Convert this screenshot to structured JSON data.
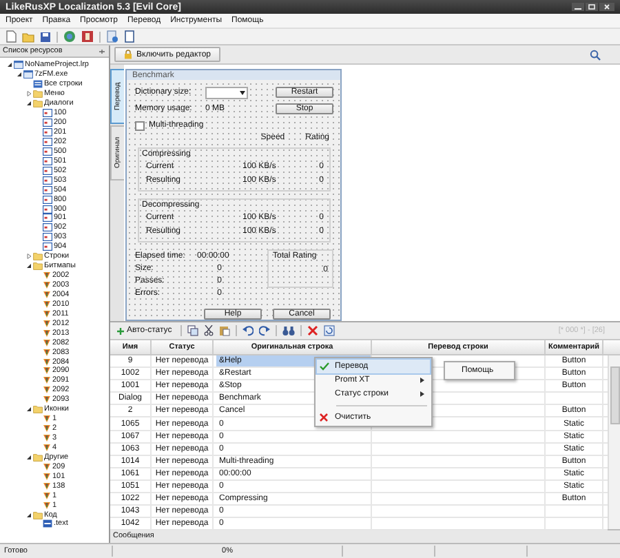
{
  "window": {
    "title": "LikeRusXP Localization 5.3  [Evil Core]"
  },
  "menu": [
    "Проект",
    "Правка",
    "Просмотр",
    "Перевод",
    "Инструменты",
    "Помощь"
  ],
  "resources": {
    "title": "Список ресурсов",
    "tree": [
      {
        "label": "NoNameProject.lrp",
        "kind": "project",
        "expanded": true,
        "children": [
          {
            "label": "7zFM.exe",
            "kind": "exe",
            "expanded": true,
            "children": [
              {
                "label": "Все строки",
                "kind": "list"
              },
              {
                "label": "Меню",
                "kind": "folder",
                "expanded": false
              },
              {
                "label": "Диалоги",
                "kind": "folder",
                "expanded": true,
                "children": [
                  {
                    "label": "100",
                    "kind": "dialog"
                  },
                  {
                    "label": "200",
                    "kind": "dialog"
                  },
                  {
                    "label": "201",
                    "kind": "dialog"
                  },
                  {
                    "label": "202",
                    "kind": "dialog"
                  },
                  {
                    "label": "500",
                    "kind": "dialog"
                  },
                  {
                    "label": "501",
                    "kind": "dialog"
                  },
                  {
                    "label": "502",
                    "kind": "dialog"
                  },
                  {
                    "label": "503",
                    "kind": "dialog"
                  },
                  {
                    "label": "504",
                    "kind": "dialog"
                  },
                  {
                    "label": "800",
                    "kind": "dialog"
                  },
                  {
                    "label": "900",
                    "kind": "dialog"
                  },
                  {
                    "label": "901",
                    "kind": "dialog"
                  },
                  {
                    "label": "902",
                    "kind": "dialog"
                  },
                  {
                    "label": "903",
                    "kind": "dialog"
                  },
                  {
                    "label": "904",
                    "kind": "dialog"
                  }
                ]
              },
              {
                "label": "Строки",
                "kind": "folder",
                "expanded": false
              },
              {
                "label": "Битмапы",
                "kind": "folder",
                "expanded": true,
                "children": [
                  {
                    "label": "2002",
                    "kind": "image"
                  },
                  {
                    "label": "2003",
                    "kind": "image"
                  },
                  {
                    "label": "2004",
                    "kind": "image"
                  },
                  {
                    "label": "2010",
                    "kind": "image"
                  },
                  {
                    "label": "2011",
                    "kind": "image"
                  },
                  {
                    "label": "2012",
                    "kind": "image"
                  },
                  {
                    "label": "2013",
                    "kind": "image"
                  },
                  {
                    "label": "2082",
                    "kind": "image"
                  },
                  {
                    "label": "2083",
                    "kind": "image"
                  },
                  {
                    "label": "2084",
                    "kind": "image"
                  },
                  {
                    "label": "2090",
                    "kind": "image"
                  },
                  {
                    "label": "2091",
                    "kind": "image"
                  },
                  {
                    "label": "2092",
                    "kind": "image"
                  },
                  {
                    "label": "2093",
                    "kind": "image"
                  }
                ]
              },
              {
                "label": "Иконки",
                "kind": "folder",
                "expanded": true,
                "children": [
                  {
                    "label": "1",
                    "kind": "image"
                  },
                  {
                    "label": "2",
                    "kind": "image"
                  },
                  {
                    "label": "3",
                    "kind": "image"
                  },
                  {
                    "label": "4",
                    "kind": "image"
                  }
                ]
              },
              {
                "label": "Другие",
                "kind": "folder",
                "expanded": true,
                "children": [
                  {
                    "label": "209",
                    "kind": "image"
                  },
                  {
                    "label": "101",
                    "kind": "image"
                  },
                  {
                    "label": "138",
                    "kind": "image"
                  },
                  {
                    "label": "1",
                    "kind": "image"
                  },
                  {
                    "label": "1",
                    "kind": "image"
                  }
                ]
              },
              {
                "label": "Код",
                "kind": "folder",
                "expanded": true,
                "children": [
                  {
                    "label": ".text",
                    "kind": "code"
                  }
                ]
              }
            ]
          }
        ]
      }
    ]
  },
  "editor_button": "Включить редактор",
  "preview_tabs": [
    {
      "label": "Перевод",
      "selected": true
    },
    {
      "label": "Оригинал",
      "selected": false
    }
  ],
  "dialog": {
    "title": "Benchmark",
    "dictionary_label": "Dictionary size:",
    "memory_label": "Memory usage:",
    "memory_value": "0 MB",
    "restart_button": "Restart",
    "stop_button": "Stop",
    "multithreading": {
      "label": "Multi-threading",
      "checked": false
    },
    "speed_header": "Speed",
    "rating_header": "Rating",
    "groups": [
      {
        "title": "Compressing",
        "rows": [
          {
            "label": "Current",
            "speed": "100 KB/s",
            "rating": "0"
          },
          {
            "label": "Resulting",
            "speed": "100 KB/s",
            "rating": "0"
          }
        ]
      },
      {
        "title": "Decompressing",
        "rows": [
          {
            "label": "Current",
            "speed": "100 KB/s",
            "rating": "0"
          },
          {
            "label": "Resulting",
            "speed": "100 KB/s",
            "rating": "0"
          }
        ]
      }
    ],
    "elapsed_label": "Elapsed time:",
    "elapsed_value": "00:00:00",
    "stats": [
      {
        "label": "Size:",
        "value": "0"
      },
      {
        "label": "Passes:",
        "value": "0"
      },
      {
        "label": "Errors:",
        "value": "0"
      }
    ],
    "total_rating_title": "Total Rating",
    "total_rating_value": "0",
    "help_button": "Help",
    "cancel_button": "Cancel"
  },
  "table_toolbar": {
    "auto_status": "Авто-статус",
    "counter": "[* 000 *] - [26]"
  },
  "table": {
    "columns": [
      "Имя",
      "Статус",
      "Оригинальная строка",
      "Перевод строки",
      "Комментарий"
    ],
    "rows": [
      {
        "name": "9",
        "status": "Нет перевода",
        "original": "&Help",
        "comment": "Button",
        "selected": true
      },
      {
        "name": "1002",
        "status": "Нет перевода",
        "original": "&Restart",
        "comment": "Button",
        "selected": false
      },
      {
        "name": "1001",
        "status": "Нет перевода",
        "original": "&Stop",
        "comment": "Button",
        "selected": false
      },
      {
        "name": "Dialog",
        "status": "Нет перевода",
        "original": "Benchmark",
        "selected": false
      },
      {
        "name": "2",
        "status": "Нет перевода",
        "original": "Cancel",
        "comment": "Button",
        "selected": false
      },
      {
        "name": "1065",
        "status": "Нет перевода",
        "original": "0",
        "comment": "Static",
        "selected": false
      },
      {
        "name": "1067",
        "status": "Нет перевода",
        "original": "0",
        "comment": "Static",
        "selected": false
      },
      {
        "name": "1063",
        "status": "Нет перевода",
        "original": "0",
        "comment": "Static",
        "selected": false
      },
      {
        "name": "1014",
        "status": "Нет перевода",
        "original": "Multi-threading",
        "comment": "Button",
        "selected": false
      },
      {
        "name": "1061",
        "status": "Нет перевода",
        "original": "00:00:00",
        "comment": "Static",
        "selected": false
      },
      {
        "name": "1051",
        "status": "Нет перевода",
        "original": "0",
        "comment": "Static",
        "selected": false
      },
      {
        "name": "1022",
        "status": "Нет перевода",
        "original": "Compressing",
        "comment": "Button",
        "selected": false
      },
      {
        "name": "1043",
        "status": "Нет перевода",
        "original": "0",
        "selected": false
      },
      {
        "name": "1042",
        "status": "Нет перевода",
        "original": "0",
        "selected": false
      }
    ]
  },
  "context_menu": {
    "items": [
      {
        "label": "Перевод",
        "kind": "check",
        "checked": true,
        "selected": true
      },
      {
        "label": "Promt XT",
        "kind": "submenu",
        "selected": false
      },
      {
        "label": "Статус строки",
        "kind": "submenu",
        "selected": false
      },
      {
        "kind": "separator"
      },
      {
        "label": "Очистить",
        "kind": "delete",
        "selected": false
      }
    ],
    "submenu": [
      "Помощь"
    ]
  },
  "messages_tab": "Сообщения",
  "status_bar": [
    "Готово",
    "0%"
  ]
}
